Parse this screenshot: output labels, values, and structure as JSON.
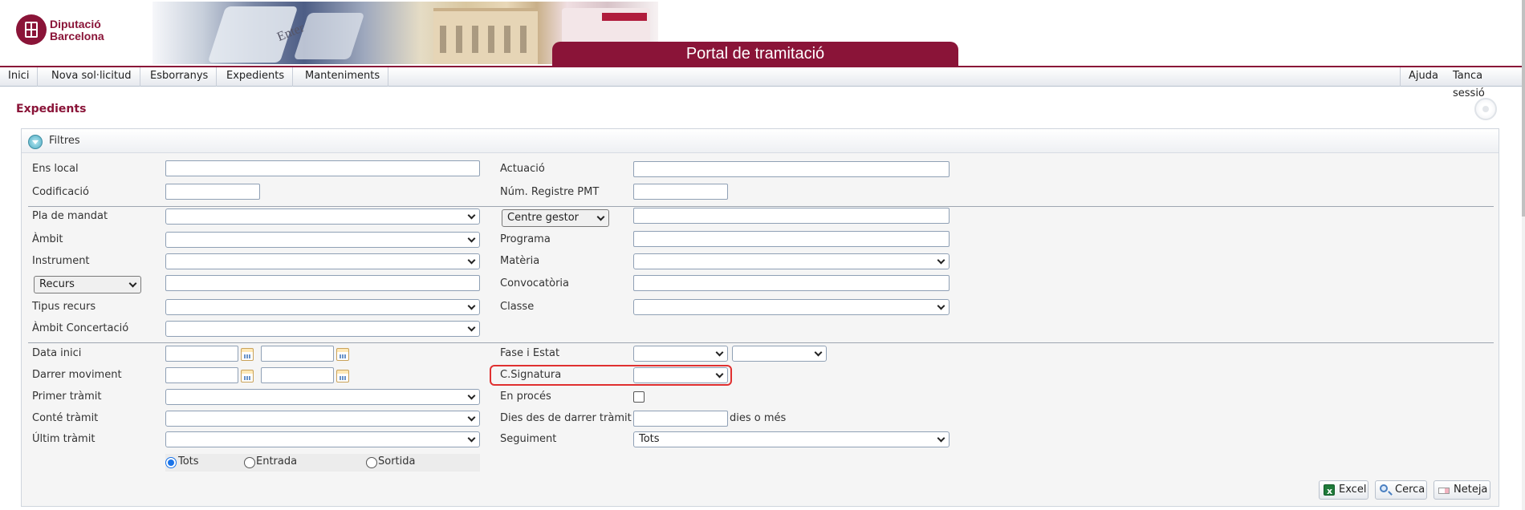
{
  "header": {
    "logo_line1": "Diputació",
    "logo_line2": "Barcelona",
    "banner_key_text": "Enter",
    "portal_title": "Portal de tramitació"
  },
  "menu": {
    "left": [
      "Inici",
      "Nova sol·licitud",
      "Esborranys",
      "Expedients",
      "Manteniments"
    ],
    "right": [
      "Ajuda",
      "Tanca sessió"
    ]
  },
  "page": {
    "title": "Expedients"
  },
  "filters": {
    "header": "Filtres",
    "labels": {
      "ens_local": "Ens local",
      "codificacio": "Codificació",
      "actuacio": "Actuació",
      "num_registre": "Núm. Registre PMT",
      "pla_mandat": "Pla de mandat",
      "ambit": "Àmbit",
      "instrument": "Instrument",
      "tipus_recurs": "Tipus recurs",
      "ambit_concertacio": "Àmbit Concertació",
      "programa": "Programa",
      "materia": "Matèria",
      "convocatoria": "Convocatòria",
      "classe": "Classe",
      "data_inici": "Data inici",
      "darrer_moviment": "Darrer moviment",
      "primer_tramit": "Primer tràmit",
      "conte_tramit": "Conté tràmit",
      "ultim_tramit": "Últim tràmit",
      "fase_estat": "Fase i Estat",
      "csignatura": "C.Signatura",
      "en_proces": "En procés",
      "dies_darrer": "Dies des de darrer tràmit",
      "dies_suffix": "dies o més",
      "seguiment": "Seguiment"
    },
    "selects": {
      "centre_gestor": "Centre gestor",
      "recurs": "Recurs",
      "seguiment_value": "Tots"
    },
    "radios": {
      "tots": "Tots",
      "entrada": "Entrada",
      "sortida": "Sortida",
      "selected": "Tots"
    },
    "en_proces_checked": false
  },
  "actions": {
    "excel": "Excel",
    "cerca": "Cerca",
    "neteja": "Neteja"
  },
  "colors": {
    "brand": "#8a1438",
    "highlight": "#e03030"
  },
  "icons": [
    "collapse-icon",
    "calendar-icon",
    "excel-icon",
    "search-icon",
    "eraser-icon",
    "help-icon"
  ]
}
